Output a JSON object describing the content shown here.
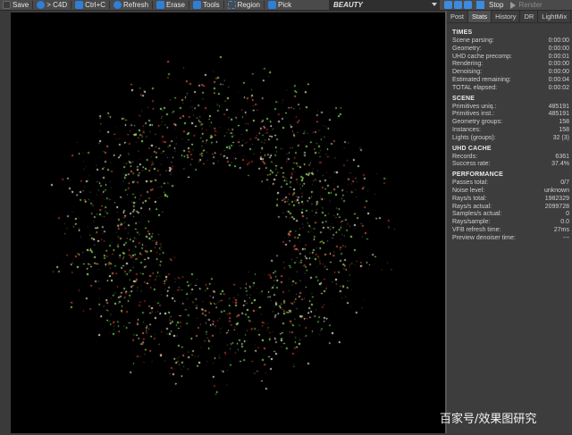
{
  "toolbar": {
    "save": "Save",
    "to_c4d": "> C4D",
    "copy": "Ctrl+C",
    "refresh": "Refresh",
    "erase": "Erase",
    "tools": "Tools",
    "region": "Region",
    "pick": "Pick",
    "channel": "BEAUTY",
    "stop": "Stop",
    "render": "Render"
  },
  "panel": {
    "tabs": [
      "Post",
      "Stats",
      "History",
      "DR",
      "LightMix"
    ],
    "active_tab": "Stats",
    "sections": [
      {
        "title": "TIMES",
        "rows": [
          {
            "label": "Scene parsing:",
            "value": "0:00:00"
          },
          {
            "label": "Geometry:",
            "value": "0:00:00"
          },
          {
            "label": "UHD cache precomp:",
            "value": "0:00:01"
          },
          {
            "label": "Rendering:",
            "value": "0:00:00"
          },
          {
            "label": "Denoising:",
            "value": "0:00:00"
          },
          {
            "label": "Estimated remaining:",
            "value": "0:00:04"
          },
          {
            "label": "TOTAL elapsed:",
            "value": "0:00:02"
          }
        ]
      },
      {
        "title": "SCENE",
        "rows": [
          {
            "label": "Primitives uniq.:",
            "value": "485191"
          },
          {
            "label": "Primitives inst.:",
            "value": "485191"
          },
          {
            "label": "Geometry groups:",
            "value": "158"
          },
          {
            "label": "Instances:",
            "value": "158"
          },
          {
            "label": "Lights (groups):",
            "value": "32 (3)"
          }
        ]
      },
      {
        "title": "UHD CACHE",
        "rows": [
          {
            "label": "Records:",
            "value": "6361"
          },
          {
            "label": "Success rate:",
            "value": "37.4%"
          }
        ]
      },
      {
        "title": "PERFORMANCE",
        "rows": [
          {
            "label": "Passes total:",
            "value": "0/7"
          },
          {
            "label": "Noise level:",
            "value": "unknown"
          },
          {
            "label": "Rays/s total:",
            "value": "1982329"
          },
          {
            "label": "Rays/s actual:",
            "value": "2099728"
          },
          {
            "label": "Samples/s actual:",
            "value": "0"
          },
          {
            "label": "Rays/sample:",
            "value": "0.0"
          },
          {
            "label": "VFB refresh time:",
            "value": "27ms"
          },
          {
            "label": "Preview denoiser time:",
            "value": "---"
          }
        ]
      }
    ]
  },
  "watermark": "百家号/效果图研究",
  "colors": {
    "accent": "#2f7fd6",
    "toolbar_bg": "#4a4a4a",
    "panel_bg": "#3d3d3d",
    "viewport_bg": "#000000",
    "speck_green": "#7fd05a",
    "speck_red": "#b8403a",
    "speck_white": "#e6e6d0"
  }
}
